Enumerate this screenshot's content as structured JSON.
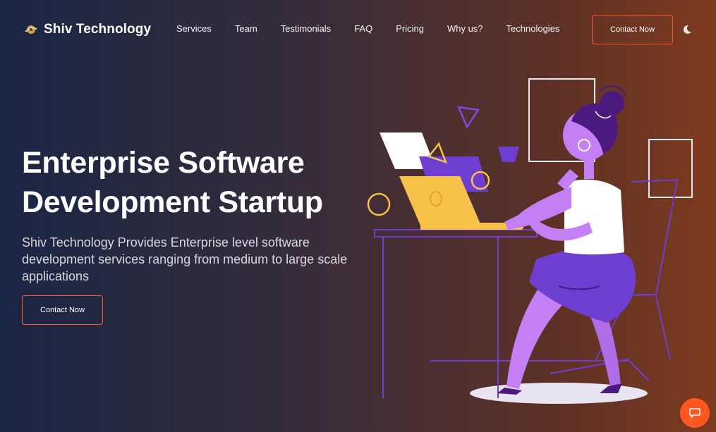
{
  "header": {
    "brand": "Shiv Technology",
    "logo_icon": "globe-icon",
    "nav": [
      "Services",
      "Team",
      "Testimonials",
      "FAQ",
      "Pricing",
      "Why us?",
      "Technologies"
    ],
    "cta_label": "Contact Now",
    "theme_icon": "moon-icon"
  },
  "hero": {
    "title_line1": "Enterprise Software",
    "title_line2": "Development Startup",
    "subtitle": "Shiv Technology Provides Enterprise level software development services ranging from medium to large scale applications",
    "cta_label": "Contact Now",
    "illustration_icon": "woman-at-laptop-illustration"
  },
  "chat": {
    "icon": "chat-icon"
  },
  "colors": {
    "accent": "#ff5722",
    "purple": "#6d3ed0",
    "violet": "#c47ff5",
    "yellow": "#f8c14a"
  }
}
